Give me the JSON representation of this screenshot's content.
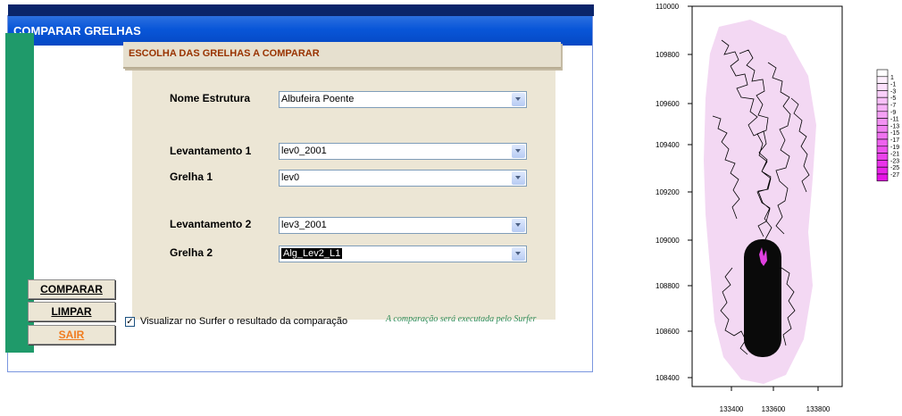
{
  "window": {
    "title": "COMPARAR GRELHAS"
  },
  "section_title": "ESCOLHA DAS GRELHAS A COMPARAR",
  "form": {
    "nome_estrutura": {
      "label": "Nome Estrutura",
      "value": "Albufeira Poente"
    },
    "levantamento1": {
      "label": "Levantamento 1",
      "value": "lev0_2001"
    },
    "grelha1": {
      "label": "Grelha 1",
      "value": "lev0"
    },
    "levantamento2": {
      "label": "Levantamento 2",
      "value": "lev3_2001"
    },
    "grelha2": {
      "label": "Grelha 2",
      "value": "Alg_Lev2_L1"
    }
  },
  "buttons": {
    "compare": "COMPARAR",
    "clear": "LIMPAR",
    "exit": "SAIR"
  },
  "checkbox": {
    "label": "Visualizar no Surfer o resultado da comparação",
    "checked": true,
    "mark": "✓"
  },
  "note": "A comparação será executada pelo Surfer",
  "plot": {
    "y_ticks": [
      "110000",
      "109800",
      "109600",
      "109400",
      "109200",
      "109000",
      "108800",
      "108600",
      "108400"
    ],
    "x_ticks": [
      "133400",
      "133600",
      "133800"
    ],
    "legend_levels": [
      "1",
      "-1",
      "-3",
      "-5",
      "-7",
      "-9",
      "-11",
      "-13",
      "-15",
      "-17",
      "-19",
      "-21",
      "-23",
      "-25",
      "-27"
    ],
    "colors": {
      "fill": "#f3d8f3",
      "dark": "#e040e0"
    }
  }
}
